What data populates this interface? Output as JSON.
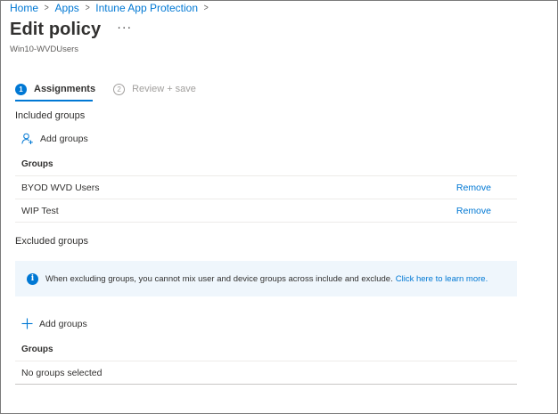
{
  "breadcrumb": {
    "items": [
      "Home",
      "Apps",
      "Intune App Protection"
    ]
  },
  "header": {
    "title": "Edit policy",
    "more_label": "···",
    "subtitle": "Win10-WVDUsers"
  },
  "steps": [
    {
      "number": "1",
      "label": "Assignments",
      "active": true
    },
    {
      "number": "2",
      "label": "Review + save",
      "active": false
    }
  ],
  "included": {
    "heading": "Included groups",
    "add_label": "Add groups",
    "column_header": "Groups",
    "rows": [
      {
        "name": "BYOD WVD Users",
        "action": "Remove"
      },
      {
        "name": "WIP Test",
        "action": "Remove"
      }
    ]
  },
  "excluded": {
    "heading": "Excluded groups",
    "info_text": "When excluding groups, you cannot mix user and device groups across include and exclude.",
    "info_link": "Click here to learn more.",
    "add_label": "Add groups",
    "column_header": "Groups",
    "empty_text": "No groups selected"
  },
  "colors": {
    "accent": "#0078d4",
    "info_background": "#eff6fc",
    "text": "#323130"
  },
  "icons": {
    "add_user": "add-user-icon",
    "plus": "plus-icon",
    "info": "info-icon",
    "chevron": "chevron-right-icon"
  }
}
